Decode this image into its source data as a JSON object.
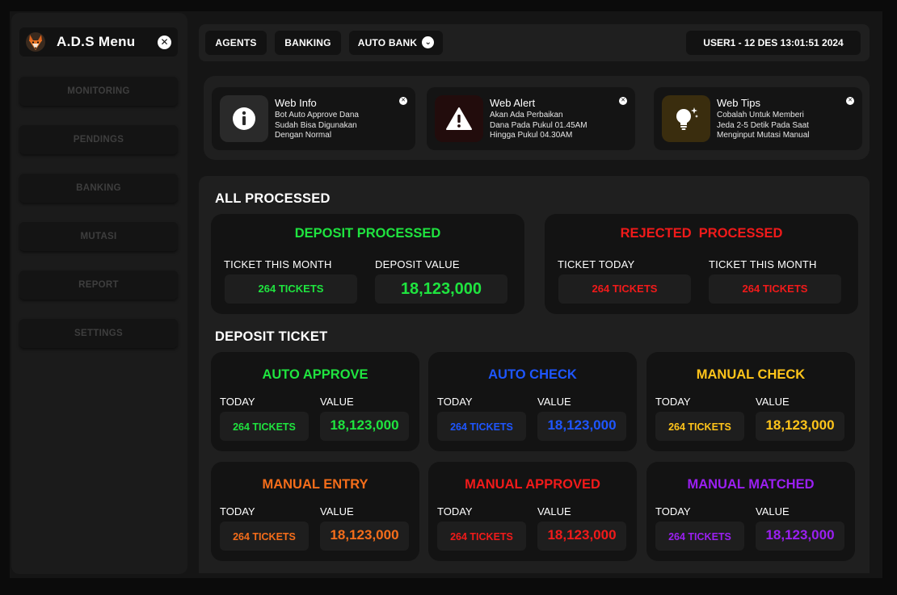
{
  "colors": {
    "green": "#1fe43f",
    "red": "#f11a1a",
    "blue": "#1e56ff",
    "yellow": "#ffc41a",
    "orange": "#f56d1a",
    "purple": "#9b1ff2"
  },
  "sidebar": {
    "brand": {
      "title": "A.D.S Menu",
      "logo_icon": "fox-logo-icon",
      "close_icon": "close-icon"
    },
    "items": [
      {
        "label": "MONITORING"
      },
      {
        "label": "PENDINGS"
      },
      {
        "label": "BANKING"
      },
      {
        "label": "MUTASI"
      },
      {
        "label": "REPORT"
      },
      {
        "label": "SETTINGS"
      }
    ]
  },
  "topbar": {
    "tabs": [
      {
        "label": "AGENTS"
      },
      {
        "label": "BANKING"
      },
      {
        "label": "AUTO BANK",
        "icon": "chevron-down-icon"
      }
    ],
    "user_status": "USER1 - 12 DES 13:01:51 2024"
  },
  "info_cards": [
    {
      "title": "Web Info",
      "icon": "info-icon",
      "icon_bg": "#2a2a2a",
      "lines": [
        "Bot Auto Approve Dana",
        "Sudah Bisa Digunakan",
        "Dengan Normal"
      ]
    },
    {
      "title": "Web Alert",
      "icon": "warning-icon",
      "icon_bg": "#220c0c",
      "lines": [
        "Akan Ada Perbaikan",
        "Dana Pada Pukul 01.45AM",
        "Hingga Pukul 04.30AM"
      ]
    },
    {
      "title": "Web Tips",
      "icon": "lightbulb-icon",
      "icon_bg": "#3a2d0e",
      "lines": [
        "Cobalah Untuk Memberi",
        "Jeda 2-5 Detik Pada Saat",
        "Menginput Mutasi Manual"
      ]
    }
  ],
  "all_processed": {
    "title": "ALL PROCESSED",
    "deposit": {
      "title": "DEPOSIT PROCESSED",
      "label1": "TICKET THIS MONTH",
      "value1": "264 TICKETS",
      "label2": "DEPOSIT VALUE",
      "value2": "18,123,000"
    },
    "rejected": {
      "title": "REJECTED  PROCESSED",
      "label1": "TICKET TODAY",
      "value1": "264 TICKETS",
      "label2": "TICKET THIS MONTH",
      "value2": "264 TICKETS"
    }
  },
  "deposit_ticket": {
    "title": "DEPOSIT TICKET",
    "cards": [
      {
        "title": "AUTO APPROVE",
        "label1": "TODAY",
        "label2": "VALUE",
        "tickets": "264 TICKETS",
        "value": "18,123,000",
        "color": "#1fe43f"
      },
      {
        "title": "AUTO CHECK",
        "label1": "TODAY",
        "label2": "VALUE",
        "tickets": "264 TICKETS",
        "value": "18,123,000",
        "color": "#1e56ff"
      },
      {
        "title": "MANUAL CHECK",
        "label1": "TODAY",
        "label2": "VALUE",
        "tickets": "264 TICKETS",
        "value": "18,123,000",
        "color": "#ffc41a"
      },
      {
        "title": "MANUAL ENTRY",
        "label1": "TODAY",
        "label2": "VALUE",
        "tickets": "264 TICKETS",
        "value": "18,123,000",
        "color": "#f56d1a"
      },
      {
        "title": "MANUAL APPROVED",
        "label1": "TODAY",
        "label2": "VALUE",
        "tickets": "264 TICKETS",
        "value": "18,123,000",
        "color": "#f11a1a"
      },
      {
        "title": "MANUAL MATCHED",
        "label1": "TODAY",
        "label2": "VALUE",
        "tickets": "264 TICKETS",
        "value": "18,123,000",
        "color": "#9b1ff2"
      }
    ]
  }
}
